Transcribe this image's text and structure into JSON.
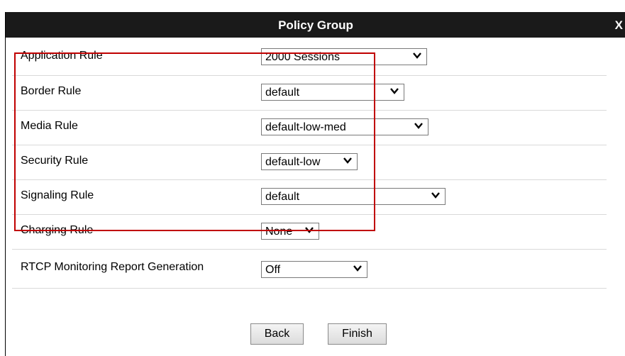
{
  "dialog": {
    "title": "Policy Group",
    "close_label": "X"
  },
  "rules": [
    {
      "label": "Application Rule",
      "value": "2000 Sessions"
    },
    {
      "label": "Border Rule",
      "value": "default"
    },
    {
      "label": "Media Rule",
      "value": "default-low-med"
    },
    {
      "label": "Security Rule",
      "value": "default-low"
    },
    {
      "label": "Signaling Rule",
      "value": "default"
    },
    {
      "label": "Charging Rule",
      "value": "None"
    },
    {
      "label": "RTCP Monitoring Report Generation",
      "value": "Off"
    }
  ],
  "buttons": {
    "back": "Back",
    "finish": "Finish"
  },
  "colors": {
    "titlebar": "#1a1a1a",
    "highlight": "#c00000"
  },
  "icons": {
    "dropdown": "chevron-down-icon"
  }
}
